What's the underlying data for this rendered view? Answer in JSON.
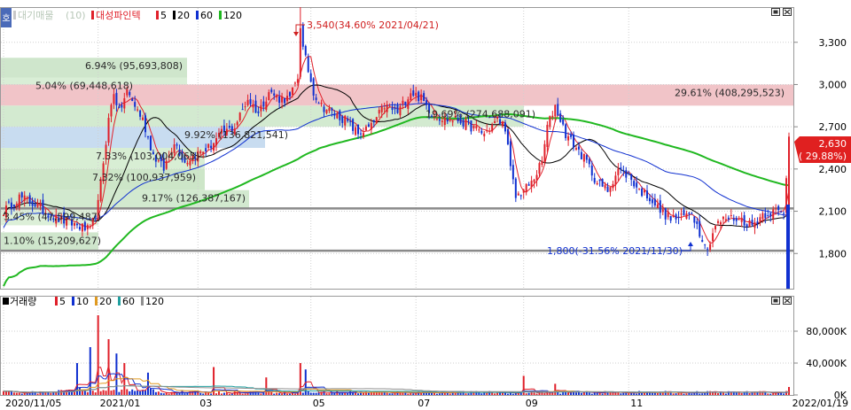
{
  "price_legend": {
    "icon": "호",
    "prefix_items": [
      "대기매물",
      "(10)"
    ],
    "stock": "대성파인텍",
    "ma_items": [
      {
        "label": "5",
        "color": "#e0202a"
      },
      {
        "label": "20",
        "color": "#000000"
      },
      {
        "label": "60",
        "color": "#1030d0"
      },
      {
        "label": "120",
        "color": "#20b820"
      }
    ]
  },
  "volume_legend": {
    "title": "거래량",
    "ma_items": [
      {
        "label": "5",
        "color": "#e0202a"
      },
      {
        "label": "10",
        "color": "#1030d0"
      },
      {
        "label": "20",
        "color": "#e09a20"
      },
      {
        "label": "60",
        "color": "#20a0a0"
      },
      {
        "label": "120",
        "color": "#909090"
      }
    ]
  },
  "annotations": {
    "high": "3,540(34.60% 2021/04/21)",
    "low": "1,800(-31.56% 2021/11/30)",
    "current_price": "2,630",
    "current_change": "( 29.88%)",
    "end_date": "2022/01/19"
  },
  "chart_data": [
    {
      "type": "candlestick",
      "ylim": [
        1550,
        3550
      ],
      "ticks": [
        3300,
        3000,
        2700,
        2400,
        2100,
        1800
      ],
      "tick_labels": [
        "3,300",
        "3,000",
        "2,700",
        "2,400",
        "2,100",
        "1,800"
      ],
      "x_labels": [
        "2020/11/05",
        "2021/01",
        "03",
        "05",
        "07",
        "09",
        "11"
      ],
      "x_label_index": [
        0,
        36,
        74,
        117,
        157,
        198,
        238
      ],
      "total_days": 300,
      "horizontal_lines": [
        2120,
        1820
      ],
      "series": [
        {
          "name": "5",
          "color": "#e0202a"
        },
        {
          "name": "20",
          "color": "#000000"
        },
        {
          "name": "60",
          "color": "#1030d0"
        },
        {
          "name": "120",
          "color": "#20b820"
        }
      ],
      "keypoints": [
        [
          0,
          2100
        ],
        [
          6,
          2200
        ],
        [
          12,
          2150
        ],
        [
          20,
          2050
        ],
        [
          28,
          2000
        ],
        [
          33,
          1960
        ],
        [
          36,
          2150
        ],
        [
          40,
          2750
        ],
        [
          42,
          2950
        ],
        [
          44,
          2800
        ],
        [
          47,
          2950
        ],
        [
          50,
          2850
        ],
        [
          53,
          2750
        ],
        [
          57,
          2500
        ],
        [
          61,
          2400
        ],
        [
          65,
          2600
        ],
        [
          69,
          2450
        ],
        [
          73,
          2500
        ],
        [
          78,
          2550
        ],
        [
          83,
          2650
        ],
        [
          88,
          2700
        ],
        [
          93,
          2900
        ],
        [
          97,
          2800
        ],
        [
          101,
          2950
        ],
        [
          105,
          2900
        ],
        [
          109,
          2900
        ],
        [
          112,
          3050
        ],
        [
          114,
          3250
        ],
        [
          116,
          3100
        ],
        [
          118,
          2950
        ],
        [
          121,
          2850
        ],
        [
          125,
          2800
        ],
        [
          130,
          2750
        ],
        [
          135,
          2650
        ],
        [
          140,
          2700
        ],
        [
          145,
          2850
        ],
        [
          150,
          2800
        ],
        [
          155,
          2950
        ],
        [
          159,
          2900
        ],
        [
          163,
          2800
        ],
        [
          168,
          2750
        ],
        [
          173,
          2750
        ],
        [
          178,
          2700
        ],
        [
          183,
          2650
        ],
        [
          188,
          2750
        ],
        [
          191,
          2700
        ],
        [
          193,
          2400
        ],
        [
          195,
          2200
        ],
        [
          198,
          2250
        ],
        [
          201,
          2300
        ],
        [
          205,
          2450
        ],
        [
          207,
          2700
        ],
        [
          210,
          2850
        ],
        [
          214,
          2650
        ],
        [
          218,
          2550
        ],
        [
          222,
          2450
        ],
        [
          226,
          2300
        ],
        [
          230,
          2250
        ],
        [
          234,
          2400
        ],
        [
          238,
          2350
        ],
        [
          242,
          2250
        ],
        [
          246,
          2200
        ],
        [
          250,
          2100
        ],
        [
          254,
          2050
        ],
        [
          258,
          2050
        ],
        [
          262,
          2100
        ],
        [
          265,
          1950
        ],
        [
          268,
          1850
        ],
        [
          271,
          2000
        ],
        [
          275,
          2050
        ],
        [
          280,
          2050
        ],
        [
          285,
          2000
        ],
        [
          289,
          2080
        ],
        [
          294,
          2100
        ],
        [
          297,
          2080
        ],
        [
          299,
          2630
        ]
      ]
    },
    {
      "type": "bar",
      "ylim": [
        0,
        100000
      ],
      "ticks": [
        80000,
        40000,
        0
      ],
      "tick_labels": [
        "80,000K",
        "40,000K",
        "0K"
      ],
      "spikes": [
        [
          36,
          100000
        ],
        [
          33,
          60000
        ],
        [
          40,
          70000
        ],
        [
          43,
          52000
        ],
        [
          46,
          40000
        ],
        [
          28,
          40000
        ],
        [
          55,
          28000
        ],
        [
          80,
          35000
        ],
        [
          113,
          40000
        ],
        [
          115,
          32000
        ],
        [
          100,
          22000
        ],
        [
          198,
          24000
        ],
        [
          210,
          14000
        ],
        [
          299,
          10000
        ]
      ]
    }
  ],
  "supply_zones": [
    {
      "label": "6.94%  (95,693,808)",
      "lo": 3050,
      "hi": 3190,
      "color": "#cfe6cc"
    },
    {
      "label": "5.04%  (69,448,618)",
      "lo": 2950,
      "hi": 3050,
      "color": "#d9eed6"
    },
    {
      "label": "29.61%  (408,295,523)",
      "lo": 2850,
      "hi": 3000,
      "color": "#f1c4c8"
    },
    {
      "label": "19.69%  (274,688,091)",
      "lo": 2700,
      "hi": 2850,
      "color": "#d3ead0"
    },
    {
      "label": "9.92%  (136,821,541)",
      "lo": 2550,
      "hi": 2700,
      "color": "#c8dcf0"
    },
    {
      "label": "7.33%  (103,004,065)",
      "lo": 2400,
      "hi": 2550,
      "color": "#d8eed4"
    },
    {
      "label": "7.32%  (100,937,959)",
      "lo": 2250,
      "hi": 2400,
      "color": "#cde6c8"
    },
    {
      "label": "9.17%  (126,387,167)",
      "lo": 2120,
      "hi": 2250,
      "color": "#d2e9cf"
    },
    {
      "label": "3.45%  (47,599,487)",
      "lo": 2000,
      "hi": 2120,
      "color": "#dcefd8"
    },
    {
      "label": "1.10%  (15,209,627)",
      "lo": 1820,
      "hi": 1950,
      "color": "#cfe6cc"
    }
  ]
}
